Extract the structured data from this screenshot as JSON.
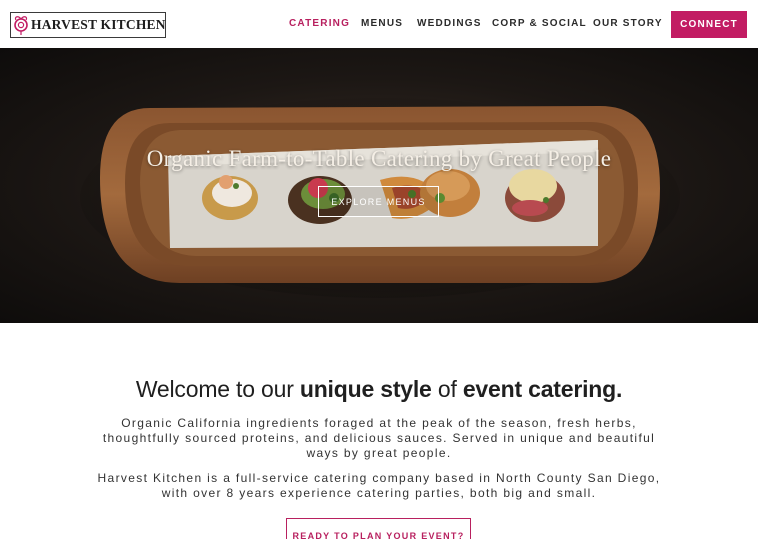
{
  "brand": {
    "name": "HARVEST KITCHEN",
    "logo_icon": "flower-icon",
    "accent_color": "#c21c63"
  },
  "nav": {
    "items": [
      {
        "label": "CATERING",
        "active": true
      },
      {
        "label": "MENUS",
        "active": false
      },
      {
        "label": "WEDDINGS",
        "active": false
      },
      {
        "label": "CORP & SOCIAL",
        "active": false
      },
      {
        "label": "OUR STORY",
        "active": false
      }
    ],
    "cta_label": "CONNECT"
  },
  "hero": {
    "title": "Organic Farm-to-Table Catering by Great People",
    "button_label": "EXPLORE MENUS"
  },
  "intro": {
    "heading_pre": "Welcome to our ",
    "heading_bold1": "unique style",
    "heading_mid": " of ",
    "heading_bold2": "event catering.",
    "paragraph1": "Organic California ingredients foraged at the peak of the season, fresh herbs, thoughtfully sourced proteins, and delicious sauces. Served in unique and beautiful ways by great people.",
    "paragraph2": "Harvest Kitchen is a full-service catering company based in North County San Diego, with over 8 years experience catering parties, both big and small.",
    "cta_label": "READY TO PLAN YOUR EVENT?"
  }
}
